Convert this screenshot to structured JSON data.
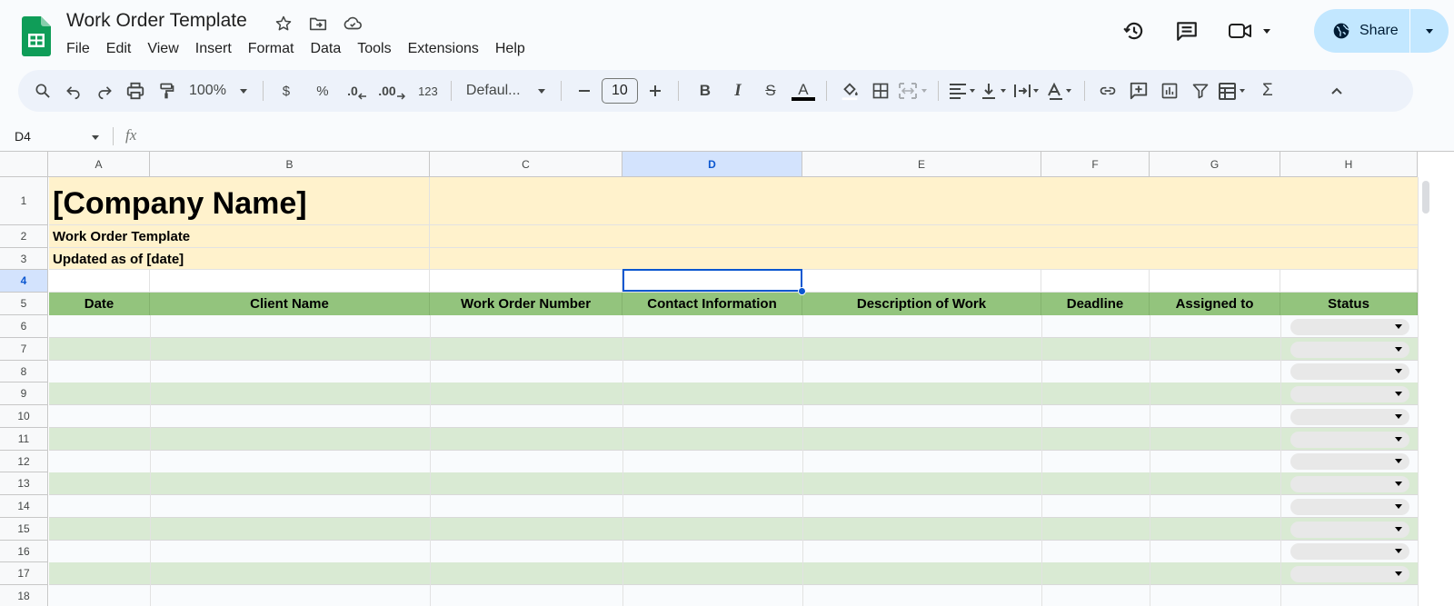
{
  "app": {
    "title": "Work Order Template",
    "menu": [
      "File",
      "Edit",
      "View",
      "Insert",
      "Format",
      "Data",
      "Tools",
      "Extensions",
      "Help"
    ],
    "share_label": "Share",
    "accent": "#c2e7ff"
  },
  "toolbar": {
    "zoom": "100%",
    "currency": "$",
    "percent": "%",
    "dec_decrease": ".0",
    "dec_increase": ".00",
    "number_format": "123",
    "font": "Defaul...",
    "font_size": "10",
    "bold": "B",
    "italic": "I",
    "strike": "S",
    "text_color": "A",
    "sum": "Σ"
  },
  "formula_bar": {
    "cell_ref": "D4",
    "fx": "fx",
    "value": ""
  },
  "sheet": {
    "columns": [
      "A",
      "B",
      "C",
      "D",
      "E",
      "F",
      "G",
      "H"
    ],
    "selected_column": "D",
    "rows": [
      "1",
      "2",
      "3",
      "4",
      "5",
      "6",
      "7",
      "8",
      "9",
      "10",
      "11",
      "12",
      "13",
      "14",
      "15",
      "16",
      "17",
      "18"
    ],
    "selected_row": "4",
    "company_name": "[Company Name]",
    "subtitle": "Work Order Template",
    "updated": "Updated as of [date]",
    "headers": [
      "Date",
      "Client Name",
      "Work Order Number",
      "Contact Information",
      "Description of Work",
      "Deadline",
      "Assigned to",
      "Status"
    ],
    "header_color": "#93c47d",
    "band_color": "#d9ead3",
    "title_fill": "#fff2cc"
  }
}
